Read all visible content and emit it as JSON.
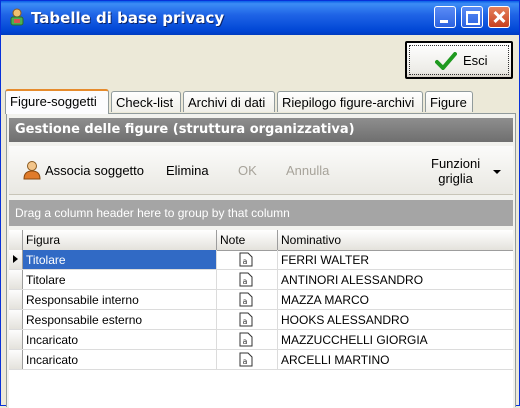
{
  "window": {
    "title": "Tabelle di base privacy",
    "buttons": {
      "minimize": "minimize",
      "maximize": "maximize",
      "close": "close"
    }
  },
  "esci_button": {
    "label": "Esci",
    "icon": "checkmark-icon",
    "icon_color": "#1f9a1f"
  },
  "tabs": [
    {
      "label": "Figure-soggetti",
      "active": true
    },
    {
      "label": "Check-list"
    },
    {
      "label": "Archivi di dati"
    },
    {
      "label": "Riepilogo figure-archivi"
    },
    {
      "label": "Figure"
    }
  ],
  "section": {
    "title": "Gestione delle figure (struttura organizzativa)"
  },
  "toolbar": {
    "associa": "Associa soggetto",
    "elimina": "Elimina",
    "ok": "OK",
    "annulla": "Annulla",
    "funzioni_line1": "Funzioni",
    "funzioni_line2": "griglia"
  },
  "groupbar": {
    "text": "Drag a column header here to group by that column"
  },
  "grid": {
    "columns": [
      "Figura",
      "Note",
      "Nominativo"
    ],
    "rows": [
      {
        "figura": "Titolare",
        "nominativo": "FERRI WALTER",
        "current": true
      },
      {
        "figura": "Titolare",
        "nominativo": "ANTINORI ALESSANDRO"
      },
      {
        "figura": "Responsabile interno",
        "nominativo": "MAZZA  MARCO"
      },
      {
        "figura": "Responsabile esterno",
        "nominativo": "HOOKS ALESSANDRO"
      },
      {
        "figura": "Incaricato",
        "nominativo": "MAZZUCCHELLI GIORGIA"
      },
      {
        "figura": "Incaricato",
        "nominativo": "ARCELLI MARTINO"
      }
    ]
  },
  "colors": {
    "titlebar": "#0046d5",
    "selection": "#316ac5",
    "header": "#7a7a7a",
    "tab_active_accent": "#e68b2c"
  }
}
